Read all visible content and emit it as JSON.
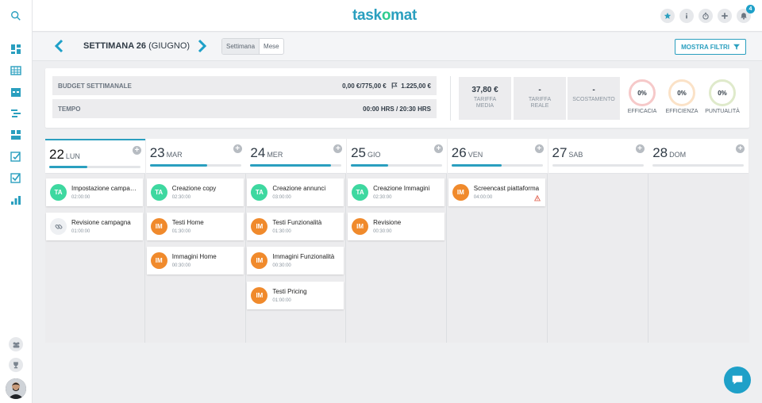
{
  "app": {
    "logo_pre": "task",
    "logo_o": "o",
    "logo_post": "mat",
    "notifications_count": "4"
  },
  "colors": {
    "accent": "#2a9fbf",
    "ta": "#3ed8a0",
    "im": "#f08a2c",
    "efficacia": "#f6c9c9",
    "efficienza": "#fbe2c7",
    "puntualita": "#dfeacb"
  },
  "sidebar": {
    "icons": [
      "search-icon",
      "dashboard-icon",
      "table-icon",
      "calendar-icon",
      "gantt-icon",
      "boards-icon",
      "edit-check-icon",
      "task-check-icon",
      "reports-icon",
      "team-icon",
      "trophy-icon"
    ]
  },
  "week": {
    "title": "SETTIMANA 26",
    "month": "(GIUGNO)",
    "view_week": "Settimana",
    "view_month": "Mese",
    "filters": "MOSTRA FILTRI"
  },
  "summary": {
    "budget_label": "BUDGET SETTIMANALE",
    "budget_value": "0,00 €/775,00 €",
    "budget_flag": "1.225,00 €",
    "time_label": "TEMPO",
    "time_value": "00:00 HRS / 20:30 HRS",
    "kpis": [
      {
        "value": "37,80 €",
        "caption1": "TARIFFA",
        "caption2": "MEDIA"
      },
      {
        "value": "-",
        "caption1": "TARIFFA",
        "caption2": "REALE"
      },
      {
        "value": "-",
        "caption1": "SCOSTAMENTO",
        "caption2": ""
      }
    ],
    "gauges": [
      {
        "value": "0%",
        "label": "EFFICACIA"
      },
      {
        "value": "0%",
        "label": "EFFICIENZA"
      },
      {
        "value": "0%",
        "label": "PUNTUALITÀ"
      }
    ]
  },
  "days": [
    {
      "num": "22",
      "name": "LUN",
      "progress": 0.42,
      "today": true,
      "tasks": [
        {
          "initials": "TA",
          "type": "ta",
          "name": "Impostazione campagna",
          "time": "02:00:00"
        },
        {
          "initials": "",
          "type": "link",
          "name": "Revisione campagna",
          "time": "01:00:00"
        }
      ]
    },
    {
      "num": "23",
      "name": "MAR",
      "progress": 0.63,
      "tasks": [
        {
          "initials": "TA",
          "type": "ta",
          "name": "Creazione copy",
          "time": "02:30:00"
        },
        {
          "initials": "IM",
          "type": "im",
          "name": "Testi Home",
          "time": "01:30:00"
        },
        {
          "initials": "IM",
          "type": "im",
          "name": "Immagini Home",
          "time": "00:30:00"
        }
      ]
    },
    {
      "num": "24",
      "name": "MER",
      "progress": 0.88,
      "tasks": [
        {
          "initials": "TA",
          "type": "ta",
          "name": "Creazione annunci",
          "time": "03:00:00"
        },
        {
          "initials": "IM",
          "type": "im",
          "name": "Testi Funzionalità",
          "time": "01:30:00"
        },
        {
          "initials": "IM",
          "type": "im",
          "name": "Immagini Funzionalità",
          "time": "00:30:00"
        },
        {
          "initials": "IM",
          "type": "im",
          "name": "Testi Pricing",
          "time": "01:00:00"
        }
      ]
    },
    {
      "num": "25",
      "name": "GIO",
      "progress": 0.41,
      "tasks": [
        {
          "initials": "TA",
          "type": "ta",
          "name": "Creazione Immagini",
          "time": "02:30:00"
        },
        {
          "initials": "IM",
          "type": "im",
          "name": "Revisione",
          "time": "00:30:00"
        }
      ]
    },
    {
      "num": "26",
      "name": "VEN",
      "progress": 0.55,
      "tasks": [
        {
          "initials": "IM",
          "type": "im",
          "name": "Screencast piattaforma",
          "time": "04:00:00",
          "warning": true
        }
      ]
    },
    {
      "num": "27",
      "name": "SAB",
      "progress": 0,
      "tasks": []
    },
    {
      "num": "28",
      "name": "DOM",
      "progress": 0,
      "tasks": []
    }
  ]
}
